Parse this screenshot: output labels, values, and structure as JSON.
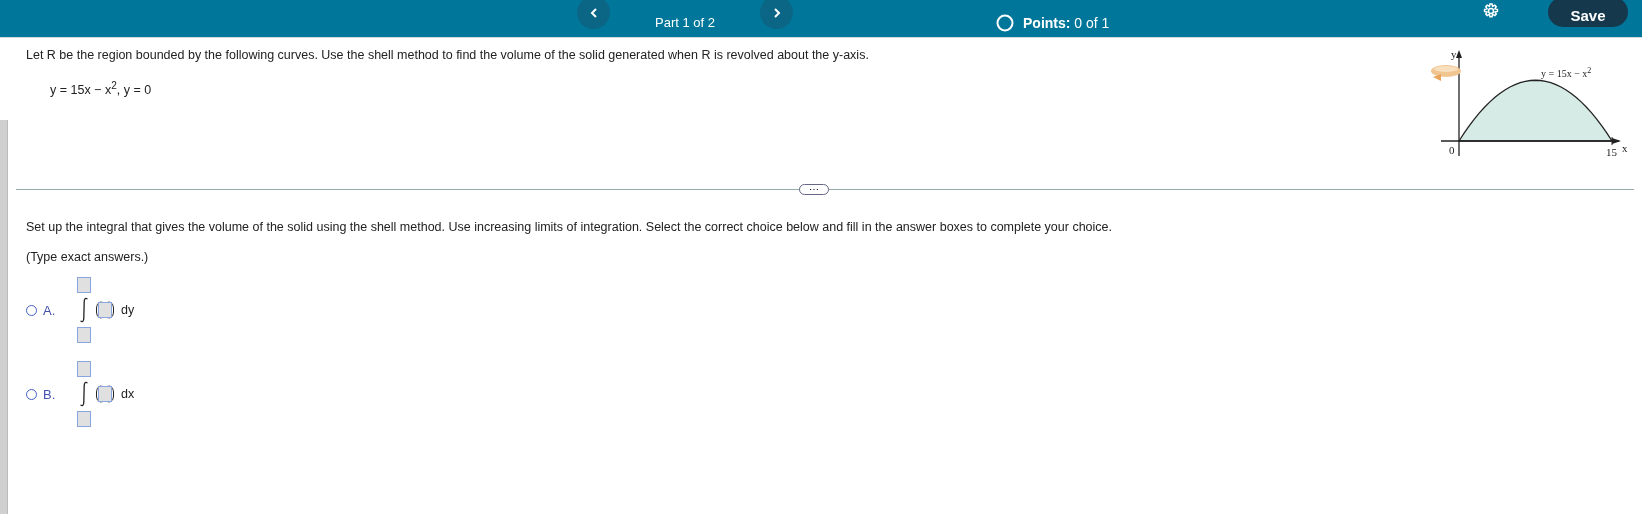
{
  "header": {
    "part": "Part 1 of 2",
    "points_label": "Points:",
    "points_value": "0 of 1",
    "save": "Save"
  },
  "question": {
    "text": "Let R be the region bounded by the following curves. Use the shell method to find the volume of the solid generated when R is revolved about the y-axis.",
    "equation": "y = 15x − x$^{2}$, y = 0"
  },
  "graph": {
    "y_label": "y",
    "x_label": "x",
    "origin": "0",
    "x_end": "15",
    "curve_label": "y = 15x − x$^{2}$"
  },
  "more": "⋯",
  "instruction": "Set up the integral that gives the volume of the solid using the shell method. Use increasing limits of integration. Select the correct choice below and fill in the answer boxes to complete your choice.",
  "hint": "(Type exact answers.)",
  "choices": [
    {
      "letter": "A.",
      "differential": "dy",
      "selected": false
    },
    {
      "letter": "B.",
      "differential": "dx",
      "selected": false
    }
  ]
}
